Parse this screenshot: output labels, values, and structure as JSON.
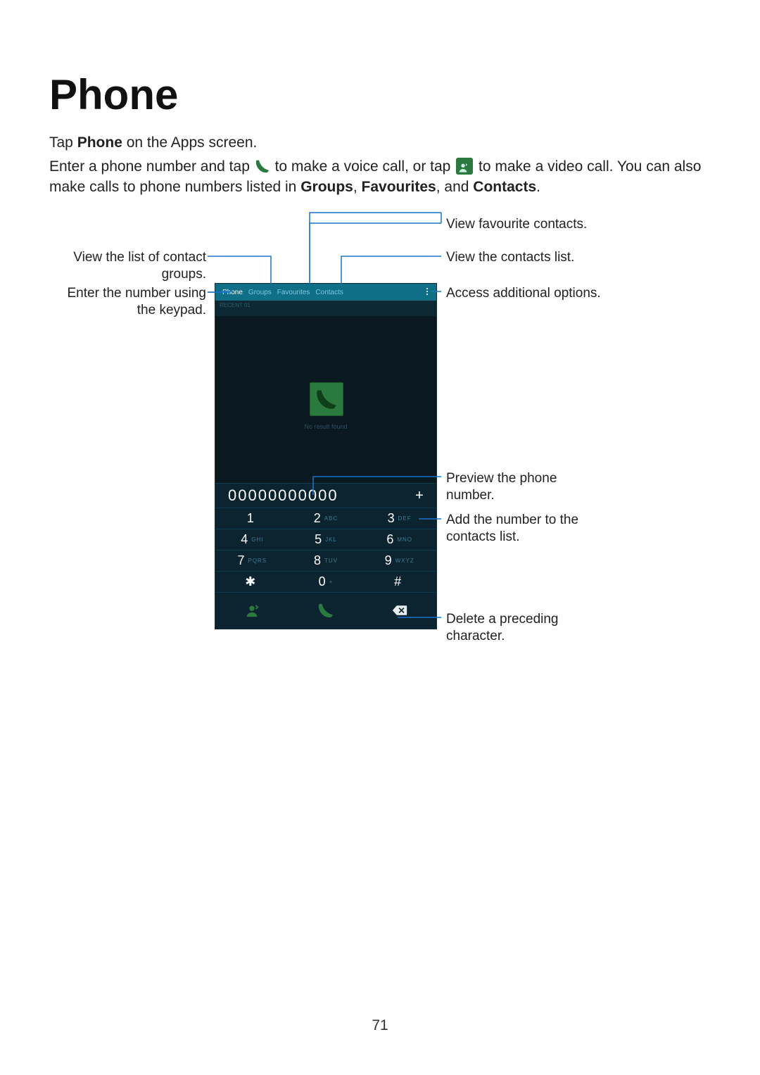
{
  "title": "Phone",
  "intro": {
    "line1_pre": "Tap ",
    "line1_bold": "Phone",
    "line1_post": " on the Apps screen.",
    "line2_pre": "Enter a phone number and tap ",
    "line2_mid": " to make a voice call, or tap ",
    "line2_post": " to make a video call. You can also make calls to phone numbers listed in ",
    "g": "Groups",
    "sep1": ", ",
    "f": "Favourites",
    "sep2": ", and ",
    "c": "Contacts",
    "period": "."
  },
  "callouts": {
    "fav": "View favourite contacts.",
    "contacts": "View the contacts list.",
    "groups1": "View the list of contact",
    "groups2": "groups.",
    "keypad1": "Enter the number using",
    "keypad2": "the keypad.",
    "options": "Access additional options.",
    "preview1": "Preview the phone",
    "preview2": "number.",
    "add1": "Add the number to the",
    "add2": "contacts list.",
    "delete1": "Delete a preceding",
    "delete2": "character."
  },
  "phone": {
    "tabs": [
      "Phone",
      "Groups",
      "Favourites",
      "Contacts"
    ],
    "status": "RECENT  01",
    "no_result": "No result found",
    "number": "00000000000",
    "add_plus": "+",
    "keys": [
      {
        "d": "1",
        "s": ""
      },
      {
        "d": "2",
        "s": "ABC"
      },
      {
        "d": "3",
        "s": "DEF"
      },
      {
        "d": "4",
        "s": "GHI"
      },
      {
        "d": "5",
        "s": "JKL"
      },
      {
        "d": "6",
        "s": "MNO"
      },
      {
        "d": "7",
        "s": "PQRS"
      },
      {
        "d": "8",
        "s": "TUV"
      },
      {
        "d": "9",
        "s": "WXYZ"
      },
      {
        "d": "✱",
        "s": ""
      },
      {
        "d": "0",
        "s": "+"
      },
      {
        "d": "#",
        "s": ""
      }
    ]
  },
  "page_number": "71"
}
